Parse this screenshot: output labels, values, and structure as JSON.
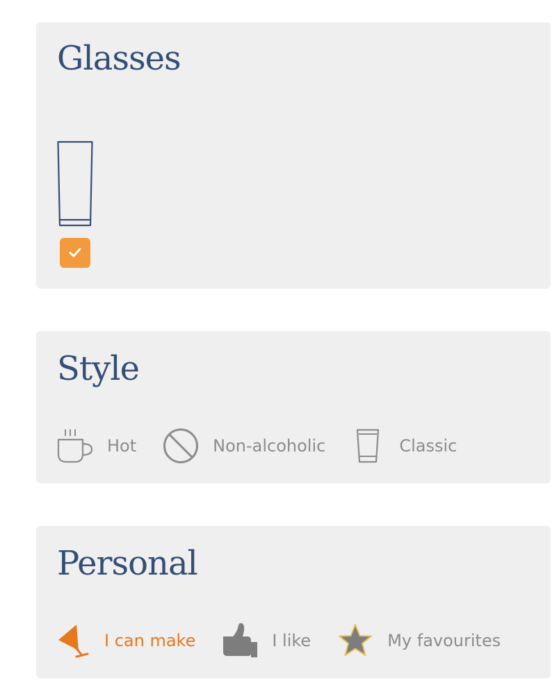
{
  "glasses": {
    "title": "Glasses",
    "items": [
      {
        "icon": "highball-glass-icon",
        "checked": true
      }
    ]
  },
  "style": {
    "title": "Style",
    "filters": [
      {
        "label": "Hot",
        "icon": "hot-cup-icon"
      },
      {
        "label": "Non-alcoholic",
        "icon": "prohibited-icon"
      },
      {
        "label": "Classic",
        "icon": "classic-glass-icon"
      }
    ]
  },
  "personal": {
    "title": "Personal",
    "filters": [
      {
        "label": "I can make",
        "icon": "cocktail-glass-icon",
        "active": true
      },
      {
        "label": "I like",
        "icon": "thumbs-up-icon"
      },
      {
        "label": "My favourites",
        "icon": "star-icon"
      }
    ]
  },
  "colors": {
    "title_blue": "#344e76",
    "accent_orange": "#e8781e",
    "checkbox_orange": "#f29a3c",
    "label_gray": "#8c8c8c",
    "icon_gray": "#7d7d7d",
    "panel_bg": "#efefef"
  }
}
